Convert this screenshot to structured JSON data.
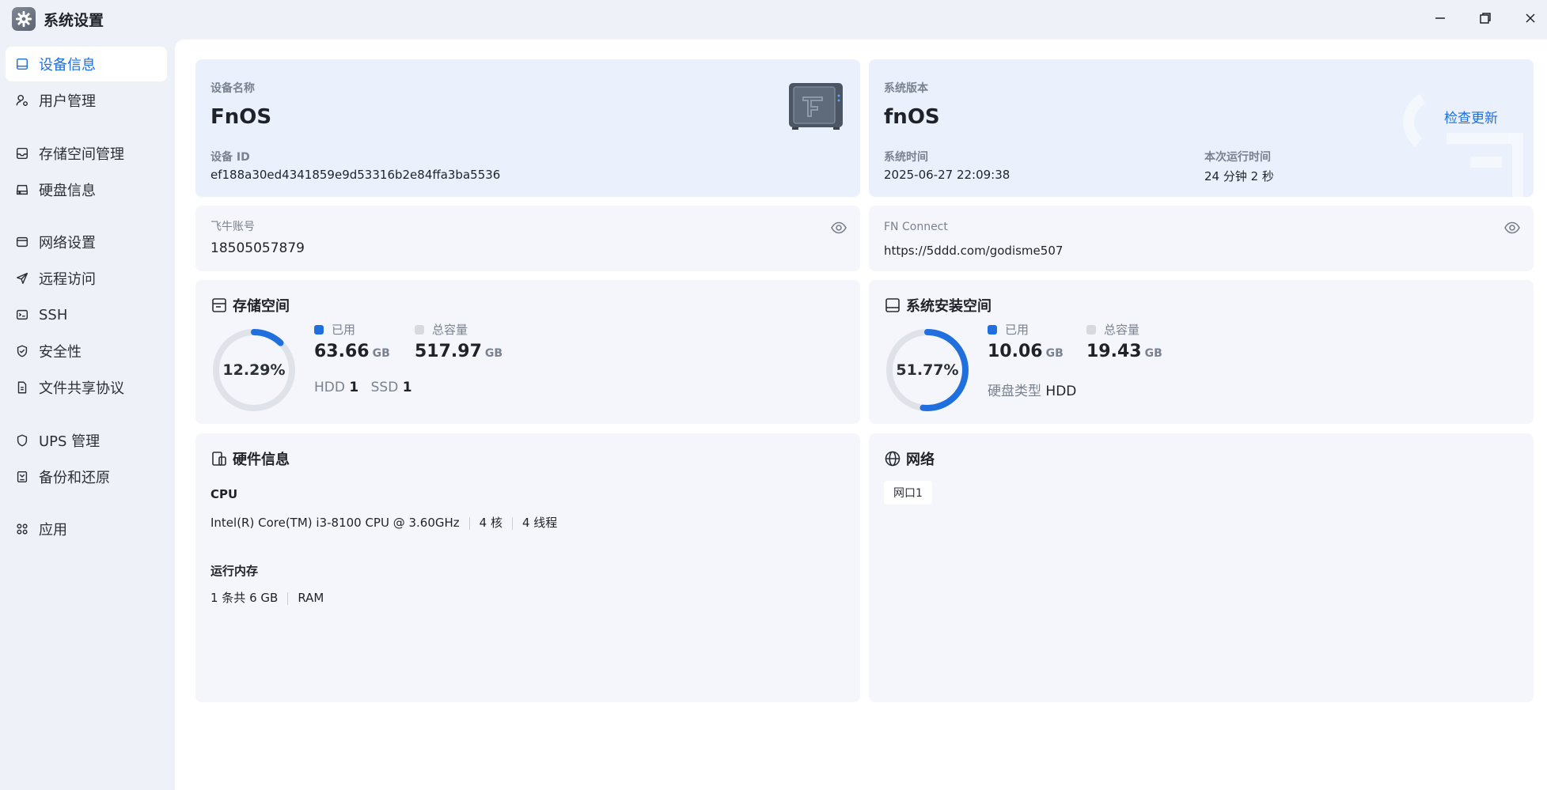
{
  "window": {
    "title": "系统设置"
  },
  "sidebar": {
    "items": [
      {
        "label": "设备信息",
        "icon": "device-icon"
      },
      {
        "label": "用户管理",
        "icon": "user-icon"
      },
      {
        "label": "存储空间管理",
        "icon": "storage-icon"
      },
      {
        "label": "硬盘信息",
        "icon": "disk-icon"
      },
      {
        "label": "网络设置",
        "icon": "network-icon"
      },
      {
        "label": "远程访问",
        "icon": "send-icon"
      },
      {
        "label": "SSH",
        "icon": "terminal-icon"
      },
      {
        "label": "安全性",
        "icon": "shield-check-icon"
      },
      {
        "label": "文件共享协议",
        "icon": "file-icon"
      },
      {
        "label": "UPS 管理",
        "icon": "shield-icon"
      },
      {
        "label": "备份和还原",
        "icon": "backup-icon"
      },
      {
        "label": "应用",
        "icon": "apps-icon"
      }
    ]
  },
  "device": {
    "name_label": "设备名称",
    "name": "FnOS",
    "id_label": "设备 ID",
    "id": "ef188a30ed4341859e9d53316b2e84ffa3ba5536"
  },
  "system": {
    "version_label": "系统版本",
    "version": "fnOS",
    "check_update": "检查更新",
    "time_label": "系统时间",
    "time": "2025-06-27 22:09:38",
    "uptime_label": "本次运行时间",
    "uptime": "24 分钟 2 秒"
  },
  "account": {
    "label": "飞牛账号",
    "value": "18505057879"
  },
  "fnconnect": {
    "label": "FN Connect",
    "value": "https://5ddd.com/godisme507"
  },
  "storage": {
    "title": "存储空间",
    "percent": "12.29%",
    "percent_value": 12.29,
    "used_label": "已用",
    "used": "63.66",
    "used_unit": "GB",
    "total_label": "总容量",
    "total": "517.97",
    "total_unit": "GB",
    "hdd_label": "HDD",
    "hdd_count": "1",
    "ssd_label": "SSD",
    "ssd_count": "1"
  },
  "sysinstall": {
    "title": "系统安装空间",
    "percent": "51.77%",
    "percent_value": 51.77,
    "used_label": "已用",
    "used": "10.06",
    "used_unit": "GB",
    "total_label": "总容量",
    "total": "19.43",
    "total_unit": "GB",
    "disk_type_label": "硬盘类型",
    "disk_type": "HDD"
  },
  "hardware": {
    "title": "硬件信息",
    "cpu_label": "CPU",
    "cpu_model": "Intel(R) Core(TM) i3-8100 CPU @ 3.60GHz",
    "cpu_cores": "4 核",
    "cpu_threads": "4 线程",
    "ram_label": "运行内存",
    "ram_count": "1 条共 6 GB",
    "ram_type": "RAM"
  },
  "network": {
    "title": "网络",
    "port": "网口1"
  },
  "colors": {
    "accent": "#1f6fde",
    "ring_track": "#dfe2e8",
    "total_dot": "#d6d9df"
  }
}
